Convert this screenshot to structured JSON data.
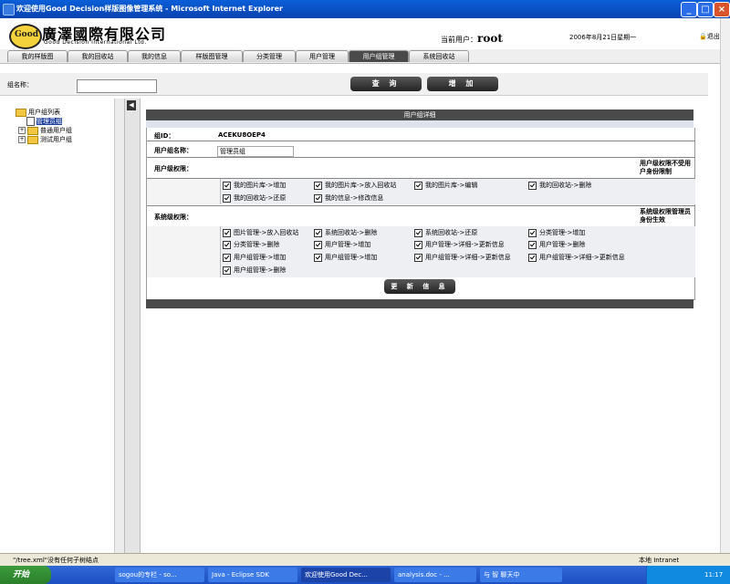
{
  "window": {
    "title": "欢迎使用Good Decision样版图像管理系统 - Microsoft Internet Explorer"
  },
  "header": {
    "logo_text": "Good",
    "company": "廣澤國際有限公司",
    "company_en": "Good Decision International Ltd.",
    "user_label": "当前用户：",
    "user_name": "root",
    "date": "2006年8月21日星期一",
    "logout": "退出"
  },
  "nav": {
    "tabs": [
      "我的样版图",
      "我的回收站",
      "我的信息",
      "样版图管理",
      "分类管理",
      "用户管理",
      "用户组管理",
      "系统回收站"
    ],
    "active_index": 6
  },
  "search": {
    "label": "组名称：",
    "value": "",
    "query_btn": "查 询",
    "add_btn": "增 加"
  },
  "tree": {
    "root": "用户组列表",
    "items": [
      "管理员组",
      "普通用户组",
      "测试用户组"
    ],
    "selected": "管理员组"
  },
  "panel": {
    "title": "用户组详细",
    "id_label": "组ID：",
    "id_value": "ACEKU8OEP4",
    "name_label": "用户组名称：",
    "name_value": "管理员组",
    "user_perm_label": "用户级权限：",
    "user_perm_note": "用户级权限不受用户身份限制",
    "user_perms": [
      "我的图片库->增加",
      "我的图片库->放入回收站",
      "我的图片库->编辑",
      "我的回收站->删除",
      "我的回收站->还原",
      "我的信息->修改信息"
    ],
    "sys_perm_label": "系统级权限：",
    "sys_perm_note": "系统级权限管理员身份生效",
    "sys_perms": [
      "图片管理->放入回收站",
      "系统回收站->删除",
      "系统回收站->还原",
      "分类管理->增加",
      "分类管理->删除",
      "用户管理->增加",
      "用户管理->详细->更新信息",
      "用户管理->删除",
      "用户组管理->增加",
      "用户组管理->增加",
      "用户组管理->详细->更新信息",
      "用户组管理->详细->更新信息",
      "用户组管理->删除"
    ],
    "update_btn": "更 新 信 息"
  },
  "status": {
    "text": "\"/tree.xml\"没有任何子树结点",
    "zone": "本地 Intranet"
  },
  "taskbar": {
    "start": "开始",
    "tasks": [
      "sogou的专栏 - so...",
      "Java - Eclipse SDK",
      "欢迎使用Good Dec...",
      "analysis.doc - ...",
      "与 智 聊天中"
    ],
    "active_index": 2,
    "clock": "11:17"
  }
}
